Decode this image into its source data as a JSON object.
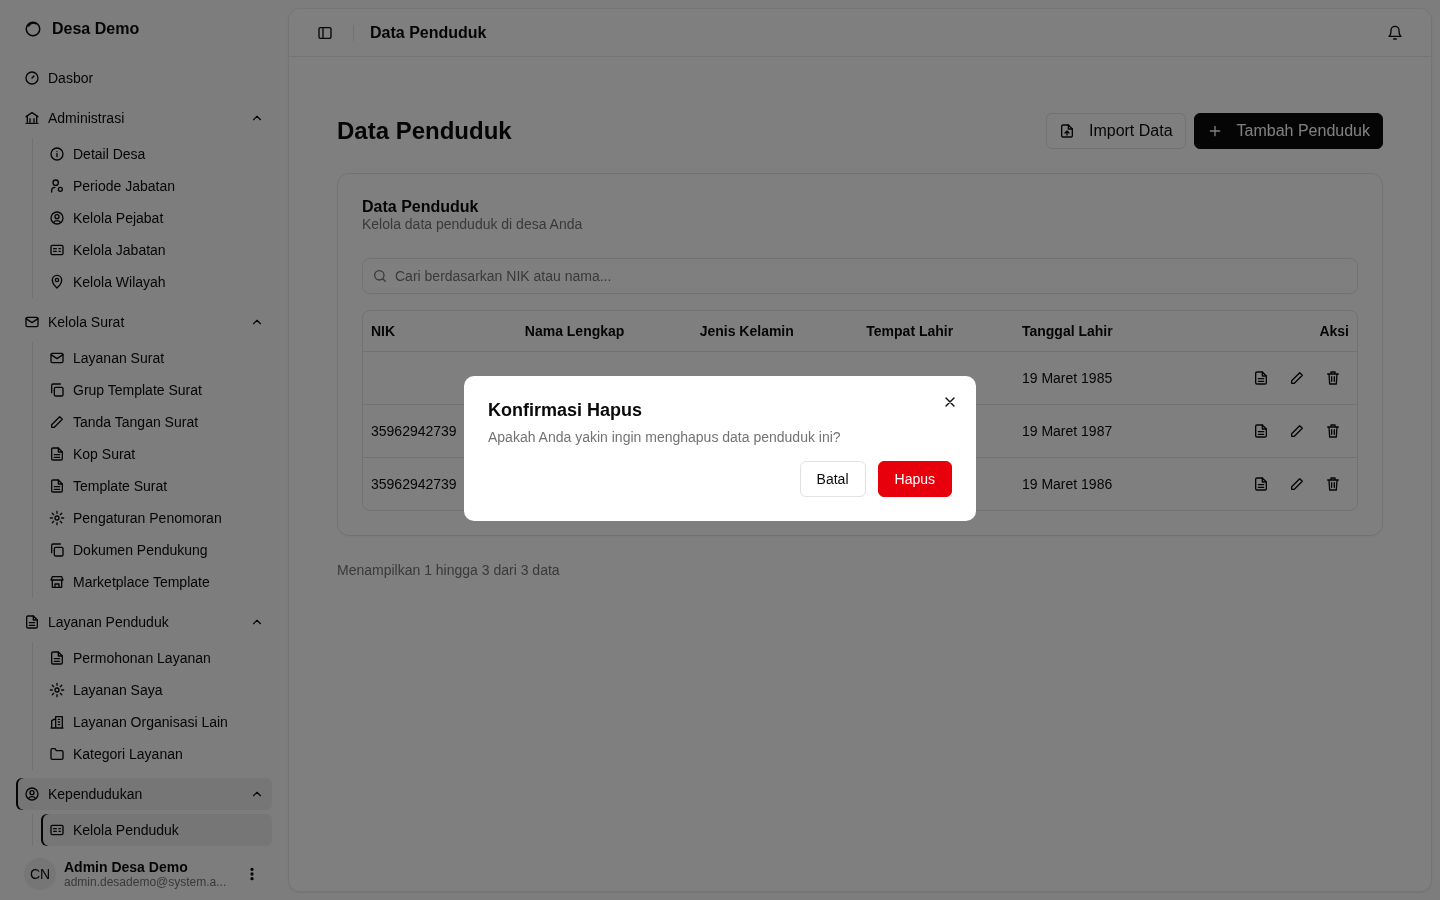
{
  "sidebar": {
    "brand": "Desa Demo",
    "items": [
      {
        "label": "Dasbor",
        "selected": false
      },
      {
        "label": "Administrasi",
        "selected": false,
        "expanded": true,
        "children": [
          {
            "label": "Detail Desa",
            "selected": false
          },
          {
            "label": "Periode Jabatan",
            "selected": false
          },
          {
            "label": "Kelola Pejabat",
            "selected": false
          },
          {
            "label": "Kelola Jabatan",
            "selected": false
          },
          {
            "label": "Kelola Wilayah",
            "selected": false
          }
        ]
      },
      {
        "label": "Kelola Surat",
        "selected": false,
        "expanded": true,
        "children": [
          {
            "label": "Layanan Surat",
            "selected": false
          },
          {
            "label": "Grup Template Surat",
            "selected": false
          },
          {
            "label": "Tanda Tangan Surat",
            "selected": false
          },
          {
            "label": "Kop Surat",
            "selected": false
          },
          {
            "label": "Template Surat",
            "selected": false
          },
          {
            "label": "Pengaturan Penomoran",
            "selected": false
          },
          {
            "label": "Dokumen Pendukung",
            "selected": false
          },
          {
            "label": "Marketplace Template",
            "selected": false
          }
        ]
      },
      {
        "label": "Layanan Penduduk",
        "selected": false,
        "expanded": true,
        "children": [
          {
            "label": "Permohonan Layanan",
            "selected": false
          },
          {
            "label": "Layanan Saya",
            "selected": false
          },
          {
            "label": "Layanan Organisasi Lain",
            "selected": false
          },
          {
            "label": "Kategori Layanan",
            "selected": false
          }
        ]
      },
      {
        "label": "Kependudukan",
        "selected": true,
        "expanded": true,
        "children": [
          {
            "label": "Kelola Penduduk",
            "selected": true
          }
        ]
      }
    ],
    "user": {
      "initials": "CN",
      "name": "Admin Desa Demo",
      "email": "admin.desademo@system.a..."
    }
  },
  "header": {
    "title": "Data Penduduk"
  },
  "page": {
    "title": "Data Penduduk",
    "buttons": [
      {
        "label": "Import Data",
        "kind": "outline"
      },
      {
        "label": "Tambah Penduduk",
        "kind": "primary"
      }
    ]
  },
  "card": {
    "title": "Data Penduduk",
    "subtitle": "Kelola data penduduk di desa Anda",
    "search": {
      "placeholder": "Cari berdasarkan NIK atau nama..."
    },
    "table": {
      "columns": [
        "NIK",
        "Nama Lengkap",
        "Jenis Kelamin",
        "Tempat Lahir",
        "Tanggal Lahir",
        "Aksi"
      ],
      "rows": [
        {
          "tanggal_lahir": "19 Maret 1985"
        },
        {
          "nik": "35962942739",
          "tanggal_lahir": "19 Maret 1987"
        },
        {
          "nik": "35962942739",
          "tanggal_lahir": "19 Maret 1986"
        }
      ]
    }
  },
  "footer": {
    "summary": "Menampilkan 1 hingga 3 dari 3 data"
  },
  "dialog": {
    "title": "Konfirmasi Hapus",
    "message": "Apakah Anda yakin ingin menghapus data penduduk ini?",
    "buttons": [
      {
        "label": "Batal",
        "kind": "secondary"
      },
      {
        "label": "Hapus",
        "kind": "destructive"
      }
    ]
  }
}
